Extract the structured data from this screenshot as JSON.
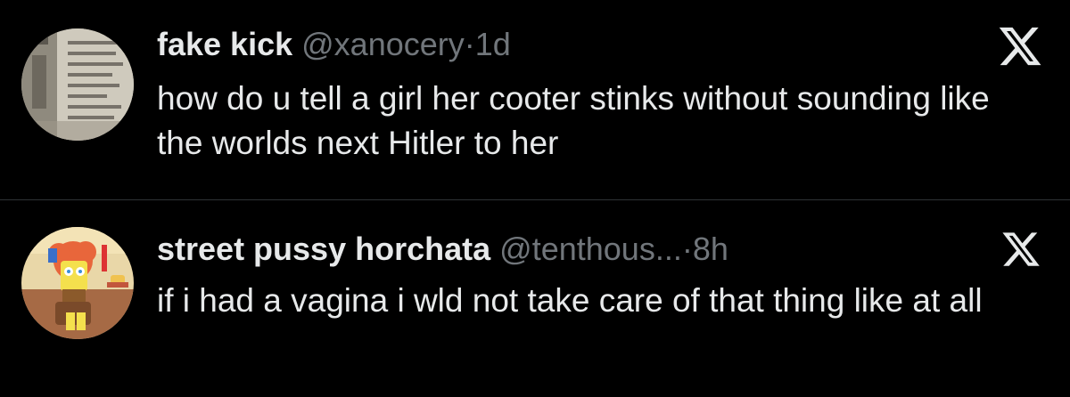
{
  "tweets": [
    {
      "display_name": "fake kick",
      "handle": "@xanocery",
      "separator": "·",
      "time": "1d",
      "text": "how do u tell a girl her cooter stinks without sounding like the worlds next Hitler to her",
      "avatar_icon": "newspaper-avatar",
      "brand_icon": "x-logo-icon"
    },
    {
      "display_name": "street pussy horchata",
      "handle": "@tenthous...",
      "separator": "·",
      "time": "8h",
      "text": "if i had a vagina i wld not take care of that thing like at all",
      "avatar_icon": "cartoon-avatar",
      "brand_icon": "x-logo-icon"
    }
  ],
  "colors": {
    "background": "#000000",
    "primary_text": "#e7e9ea",
    "secondary_text": "#71767b",
    "divider": "#2f3336"
  }
}
